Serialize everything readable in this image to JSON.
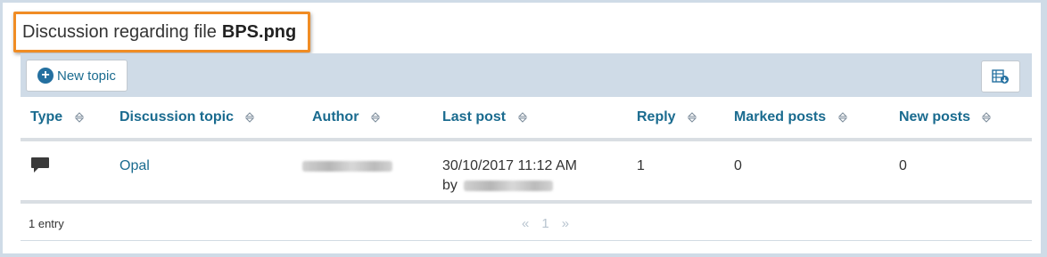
{
  "header": {
    "title_prefix": "Discussion regarding file",
    "file_name": "BPS.png"
  },
  "toolbar": {
    "new_topic_label": "New topic",
    "export_icon": "table-export-icon"
  },
  "table": {
    "columns": [
      "Type",
      "Discussion topic",
      "Author",
      "Last post",
      "Reply",
      "Marked posts",
      "New posts"
    ],
    "rows": [
      {
        "type_icon": "chat-bubble-icon",
        "topic": "Opal",
        "author": "",
        "last_post_date": "30/10/2017 11:12 AM",
        "last_post_by_label": "by",
        "last_post_by": "",
        "reply": "1",
        "marked_posts": "0",
        "new_posts": "0"
      }
    ]
  },
  "footer": {
    "entries": "1 entry",
    "pager": {
      "prev": "«",
      "page": "1",
      "next": "»"
    }
  },
  "colors": {
    "accent": "#1a6b8f",
    "highlight_border": "#f08c24",
    "toolbar_bg": "#cfdbe7"
  }
}
